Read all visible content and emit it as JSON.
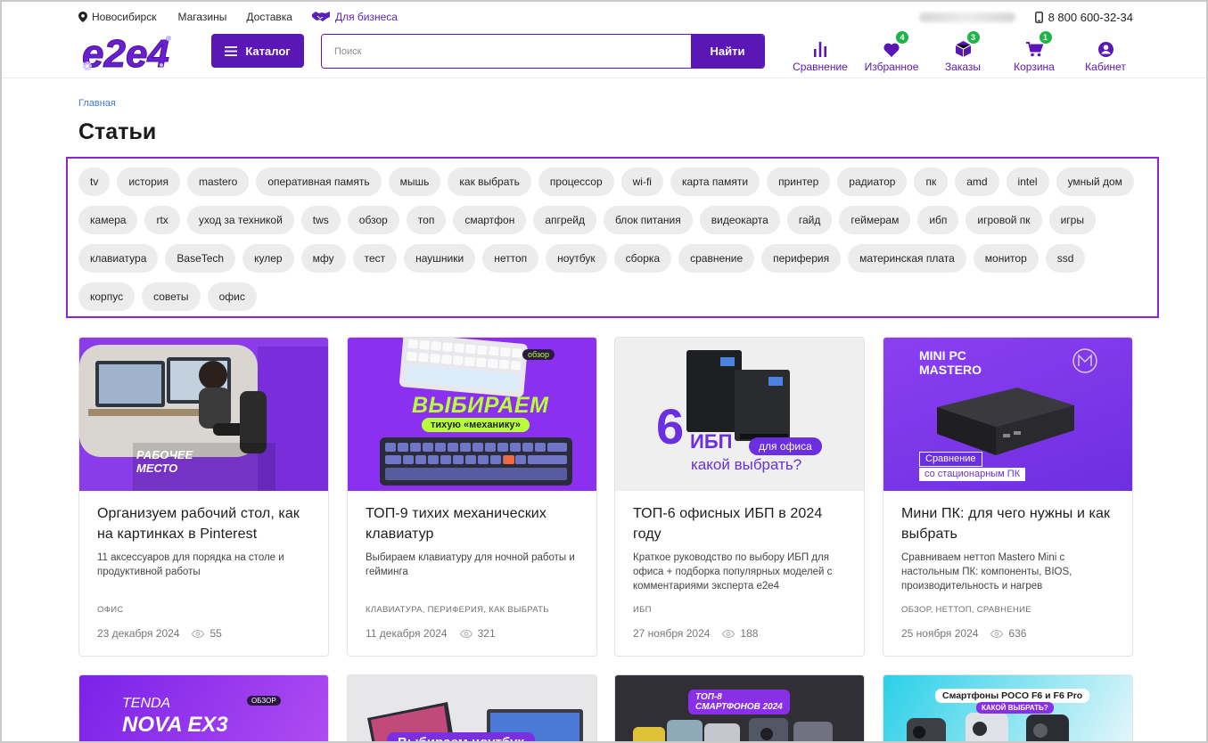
{
  "topbar": {
    "city": "Новосибирск",
    "stores": "Магазины",
    "delivery": "Доставка",
    "business": "Для бизнеса",
    "phone": "8 800 600-32-34"
  },
  "header": {
    "logo_text": "e2e4",
    "catalog_label": "Каталог",
    "search_placeholder": "Поиск",
    "search_button": "Найти",
    "icons": [
      {
        "label": "Сравнение",
        "icon": "compare-icon",
        "badge": ""
      },
      {
        "label": "Избранное",
        "icon": "heart-icon",
        "badge": "4"
      },
      {
        "label": "Заказы",
        "icon": "box-icon",
        "badge": "3"
      },
      {
        "label": "Корзина",
        "icon": "cart-icon",
        "badge": "1"
      },
      {
        "label": "Кабинет",
        "icon": "user-icon",
        "badge": ""
      }
    ]
  },
  "breadcrumb": "Главная",
  "page_title": "Статьи",
  "tags": [
    "tv",
    "история",
    "mastero",
    "оперативная память",
    "мышь",
    "как выбрать",
    "процессор",
    "wi-fi",
    "карта памяти",
    "принтер",
    "радиатор",
    "пк",
    "amd",
    "intel",
    "умный дом",
    "камера",
    "rtx",
    "уход за техникой",
    "tws",
    "обзор",
    "топ",
    "смартфон",
    "апгрейд",
    "блок питания",
    "видеокарта",
    "гайд",
    "геймерам",
    "ибп",
    "игровой пк",
    "игры",
    "клавиатура",
    "BaseTech",
    "кулер",
    "мфу",
    "тест",
    "наушники",
    "неттоп",
    "ноутбук",
    "сборка",
    "сравнение",
    "периферия",
    "материнская плата",
    "монитор",
    "ssd",
    "корпус",
    "советы",
    "офис"
  ],
  "articles": [
    {
      "title": "Организуем рабочий стол, как на картинках в Pinterest",
      "desc": "11 аксессуаров для порядка на столе и продуктивной работы",
      "tags": "ОФИС",
      "date": "23 декабря 2024",
      "views": "55",
      "image_text": [
        "РАБОЧЕЕ",
        "МЕСТО"
      ]
    },
    {
      "title": "ТОП-9 тихих механических клавиатур",
      "desc": "Выбираем клавиатуру для ночной работы и гейминга",
      "tags": "КЛАВИАТУРА, ПЕРИФЕРИЯ, КАК ВЫБРАТЬ",
      "date": "11 декабря 2024",
      "views": "321",
      "image_text": [
        "ВЫБИРАЕМ",
        "тихую «механику»",
        "обзор"
      ]
    },
    {
      "title": "ТОП-6 офисных ИБП в 2024 году",
      "desc": "Краткое руководство по выбору ИБП для офиса + подборка популярных моделей с комментариями эксперта e2e4",
      "tags": "ИБП",
      "date": "27 ноября 2024",
      "views": "188",
      "image_text": [
        "6",
        "ИБП",
        "для офиса",
        "какой выбрать?"
      ]
    },
    {
      "title": "Мини ПК: для чего нужны и как выбрать",
      "desc": "Сравниваем неттоп Mastero Mini с настольным ПК: компоненты, BIOS, производительность и нагрев",
      "tags": "ОБЗОР, НЕТТОП, СРАВНЕНИЕ",
      "date": "25 ноября 2024",
      "views": "636",
      "image_text": [
        "MINI PC",
        "MASTERO",
        "Сравнение",
        "со стационарным ПК"
      ]
    }
  ],
  "articles_row2": [
    {
      "image_text": [
        "TENDA",
        "NOVA EX3",
        "ОБЗОР"
      ]
    },
    {
      "image_text": [
        "Выбираем ноутбук"
      ]
    },
    {
      "image_text": [
        "ТОП-8",
        "СМАРТФОНОВ 2024"
      ]
    },
    {
      "image_text": [
        "Смартфоны POCO F6 и F6 Pro",
        "КАКОЙ ВЫБРАТЬ?"
      ]
    }
  ],
  "colors": {
    "brand": "#5a17b5",
    "accent": "#8a24d6",
    "badge": "#1fb54a",
    "link": "#3d7bd9"
  }
}
